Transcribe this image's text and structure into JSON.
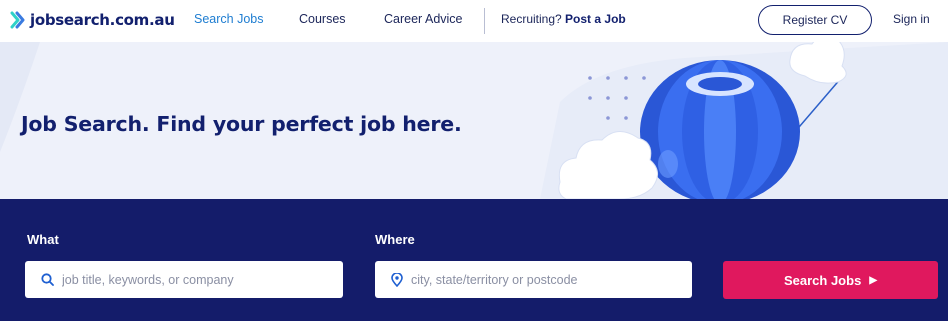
{
  "nav": {
    "logo_text": "jobsearch.com.au",
    "links": [
      {
        "label": "Search Jobs",
        "active": true
      },
      {
        "label": "Courses",
        "active": false
      },
      {
        "label": "Career Advice",
        "active": false
      }
    ],
    "recruiting_prefix": "Recruiting?",
    "post_job_label": "Post a Job",
    "register_label": "Register CV",
    "signin_label": "Sign in"
  },
  "hero": {
    "title": "Job Search. Find your perfect job here."
  },
  "search": {
    "what_label": "What",
    "what_placeholder": "job title, keywords, or company",
    "where_label": "Where",
    "where_placeholder": "city, state/territory or postcode",
    "button_label": "Search Jobs",
    "button_arrow": "▶"
  },
  "colors": {
    "brand_navy": "#141c6a",
    "accent_blue": "#1e7dd1",
    "cta_pink": "#e0185e",
    "hero_bg": "#eef1fa"
  },
  "icons": [
    "logo-chevron-icon",
    "search-icon",
    "location-pin-icon",
    "play-arrow-icon",
    "hot-air-balloon",
    "cloud"
  ]
}
